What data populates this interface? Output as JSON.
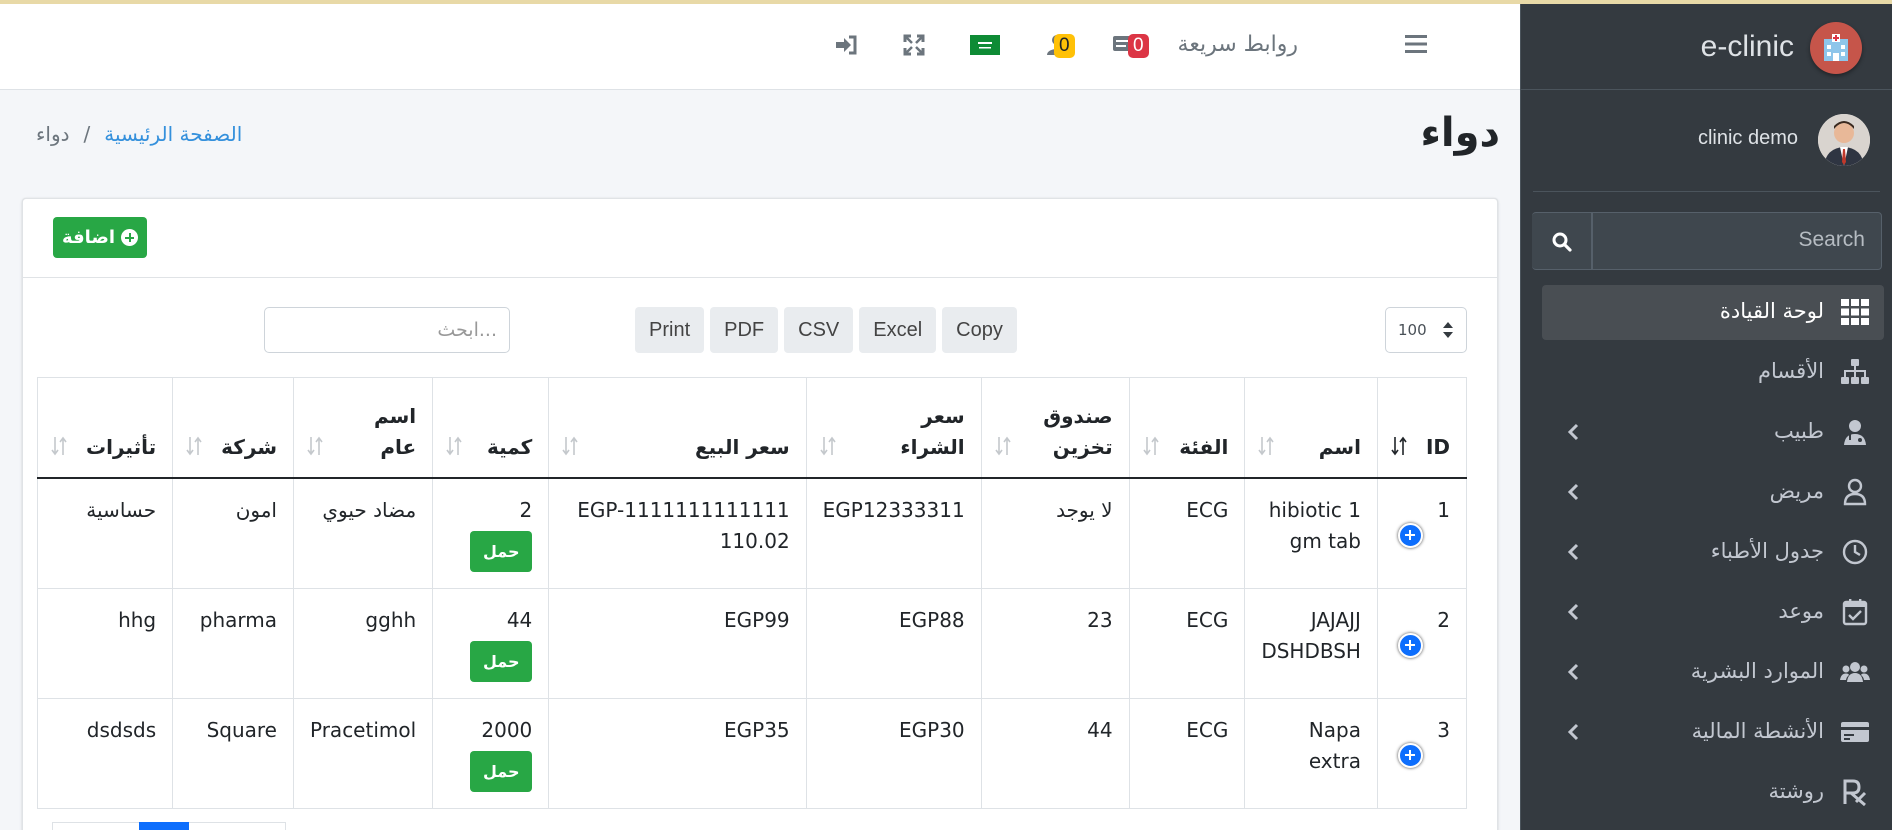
{
  "sidebar": {
    "brand": "e-clinic",
    "user_name": "clinic demo",
    "search_placeholder": "Search",
    "items": [
      {
        "label": "لوحة القيادة",
        "icon": "grid-icon",
        "active": true
      },
      {
        "label": "الأقسام",
        "icon": "sitemap-icon"
      },
      {
        "label": "طبيب",
        "icon": "doctor-icon"
      },
      {
        "label": "مريض",
        "icon": "user-icon"
      },
      {
        "label": "جدول الأطباء",
        "icon": "clock-icon"
      },
      {
        "label": "موعد",
        "icon": "calendar-check-icon"
      },
      {
        "label": "الموارد البشرية",
        "icon": "users-icon"
      },
      {
        "label": "الأنشطة المالية",
        "icon": "credit-card-icon"
      },
      {
        "label": "روشتة",
        "icon": "prescription-icon"
      }
    ]
  },
  "navbar": {
    "quick_links": "روابط سريعة",
    "messages_count": "0",
    "notifications_count": "0"
  },
  "page": {
    "title": "دواء",
    "breadcrumb_home": "الصفحة الرئيسية",
    "breadcrumb_current": "دواء"
  },
  "card": {
    "add_label": "اضافة",
    "page_length": "100",
    "export_buttons": [
      "Copy",
      "Excel",
      "CSV",
      "PDF",
      "Print"
    ],
    "search_placeholder": "ابحث..."
  },
  "table": {
    "headers": [
      "ID",
      "اسم",
      "الفئة",
      "صندوق تخزين",
      "سعر الشراء",
      "سعر البيع",
      "كمية",
      "اسم عام",
      "شركة",
      "تأثيرات"
    ],
    "load_label": "حمل",
    "rows": [
      {
        "id": "1",
        "name": "hibiotic 1 gm tab",
        "category": "ECG",
        "storage": "لا يوجد",
        "buy": "EGP12333311",
        "sell": "EGP-1111111111111110.02",
        "qty": "2",
        "generic": "مضاد حيوي",
        "company": "امون",
        "effects": "حساسية"
      },
      {
        "id": "2",
        "name": "JAJAJJ DSHDBSH",
        "category": "ECG",
        "storage": "23",
        "buy": "EGP88",
        "sell": "EGP99",
        "qty": "44",
        "generic": "gghh",
        "company": "pharma",
        "effects": "hhg"
      },
      {
        "id": "3",
        "name": "Napa extra",
        "category": "ECG",
        "storage": "44",
        "buy": "EGP30",
        "sell": "EGP35",
        "qty": "2000",
        "generic": "Pracetimol",
        "company": "Square",
        "effects": "dsdsds"
      }
    ]
  },
  "colors": {
    "sidebar_bg": "#343a40",
    "accent_green": "#28a745",
    "link_blue": "#3490dc",
    "badge_red": "#dc3545",
    "badge_yellow": "#ffc107"
  }
}
